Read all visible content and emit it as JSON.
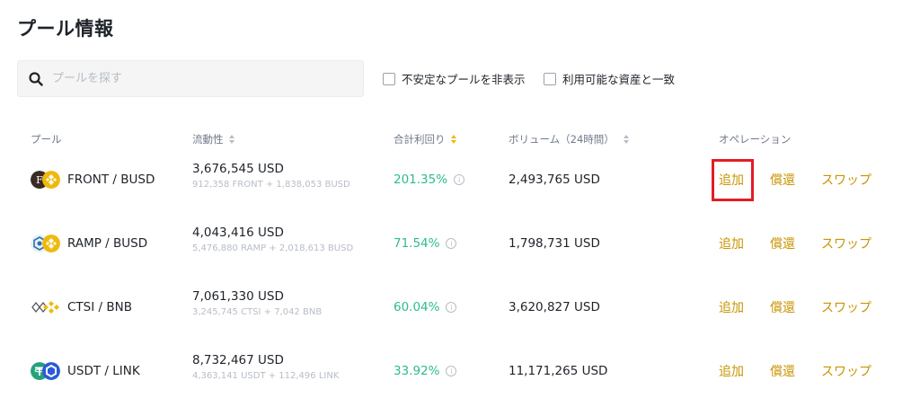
{
  "page": {
    "title": "プール情報"
  },
  "search": {
    "placeholder": "プールを探す"
  },
  "filters": [
    {
      "label": "不安定なプールを非表示",
      "checked": false
    },
    {
      "label": "利用可能な資産と一致",
      "checked": false
    }
  ],
  "table": {
    "headers": {
      "pool": "プール",
      "liquidity": "流動性",
      "apr": "合計利回り",
      "volume": "ボリューム（24時間）",
      "operations": "オペレーション"
    },
    "rows": [
      {
        "pair": "FRONT / BUSD",
        "icons": [
          "front-coin-icon",
          "busd-coin-icon"
        ],
        "liquidity": "3,676,545 USD",
        "liquidity_detail": "912,358 FRONT + 1,838,053 BUSD",
        "apr": "201.35%",
        "volume": "2,493,765 USD"
      },
      {
        "pair": "RAMP / BUSD",
        "icons": [
          "ramp-coin-icon",
          "busd-coin-icon"
        ],
        "liquidity": "4,043,416 USD",
        "liquidity_detail": "5,476,880 RAMP + 2,018,613 BUSD",
        "apr": "71.54%",
        "volume": "1,798,731 USD"
      },
      {
        "pair": "CTSI / BNB",
        "icons": [
          "ctsi-coin-icon",
          "bnb-coin-icon"
        ],
        "liquidity": "7,061,330 USD",
        "liquidity_detail": "3,245,745 CTSI + 7,042 BNB",
        "apr": "60.04%",
        "volume": "3,620,827 USD"
      },
      {
        "pair": "USDT / LINK",
        "icons": [
          "usdt-coin-icon",
          "link-coin-icon"
        ],
        "liquidity": "8,732,467 USD",
        "liquidity_detail": "4,363,141 USDT + 112,496 LINK",
        "apr": "33.92%",
        "volume": "11,171,265 USD"
      }
    ],
    "operations": {
      "add": "追加",
      "redeem": "償還",
      "swap": "スワップ"
    }
  },
  "colors": {
    "accent": "#c99400",
    "positive": "#2ebd85",
    "highlight": "#e31c25"
  }
}
